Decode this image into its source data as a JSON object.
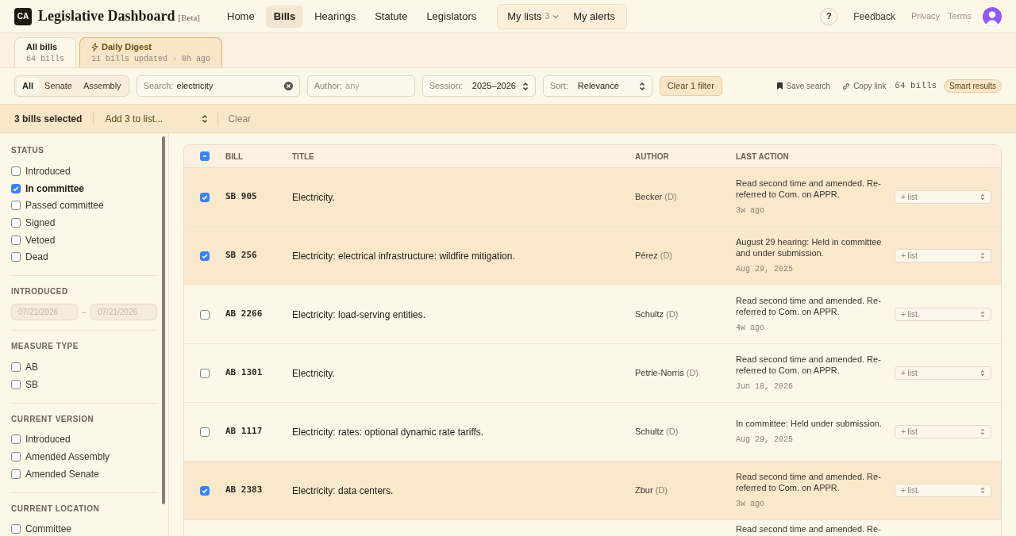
{
  "header": {
    "logo": "CA",
    "title": "Legislative Dashboard",
    "badge": "[Beta]",
    "nav": [
      {
        "label": "Home",
        "selected": false
      },
      {
        "label": "Bills",
        "selected": true
      },
      {
        "label": "Hearings",
        "selected": false
      },
      {
        "label": "Statute",
        "selected": false
      },
      {
        "label": "Legislators",
        "selected": false
      }
    ],
    "my_lists": {
      "label": "My lists",
      "count": "3"
    },
    "my_alerts": "My alerts",
    "help": "?",
    "feedback": "Feedback",
    "links": [
      "Privacy",
      "Terms"
    ]
  },
  "tabs": [
    {
      "label": "All bills",
      "sub": "64 bills",
      "selected": true,
      "kind": "plain"
    },
    {
      "label": "Daily Digest",
      "sub": "11 bills updated · 8h ago",
      "selected": false,
      "kind": "digest"
    }
  ],
  "filters": {
    "chamber": [
      {
        "label": "All",
        "selected": true
      },
      {
        "label": "Senate",
        "selected": false
      },
      {
        "label": "Assembly",
        "selected": false
      }
    ],
    "search": {
      "label": "Search:",
      "value": "electricity"
    },
    "author": {
      "label": "Author:",
      "placeholder": "any"
    },
    "session": {
      "label": "Session:",
      "value": "2025–2026"
    },
    "sort": {
      "label": "Sort:",
      "value": "Relevance"
    },
    "clear": "Clear 1 filter",
    "save": "Save search",
    "copy": "Copy link",
    "count": "64 bills",
    "smart": "Smart results"
  },
  "selection_bar": {
    "text": "3 bills selected",
    "action": "Add 3 to list...",
    "clear": "Clear"
  },
  "sidebar": [
    {
      "title": "STATUS",
      "kind": "checks",
      "items": [
        {
          "label": "Introduced",
          "checked": false
        },
        {
          "label": "In committee",
          "checked": true
        },
        {
          "label": "Passed committee",
          "checked": false
        },
        {
          "label": "Signed",
          "checked": false
        },
        {
          "label": "Vetoed",
          "checked": false
        },
        {
          "label": "Dead",
          "checked": false
        }
      ]
    },
    {
      "title": "INTRODUCED",
      "kind": "dates",
      "from": "07/21/2026",
      "to": "07/21/2026",
      "separator": "–"
    },
    {
      "title": "MEASURE TYPE",
      "kind": "checks",
      "items": [
        {
          "label": "AB",
          "checked": false
        },
        {
          "label": "SB",
          "checked": false
        }
      ]
    },
    {
      "title": "CURRENT VERSION",
      "kind": "checks",
      "items": [
        {
          "label": "Introduced",
          "checked": false
        },
        {
          "label": "Amended Assembly",
          "checked": false
        },
        {
          "label": "Amended Senate",
          "checked": false
        }
      ]
    },
    {
      "title": "CURRENT LOCATION",
      "kind": "checks",
      "items": [
        {
          "label": "Committee",
          "checked": false
        }
      ]
    }
  ],
  "table": {
    "header_checkbox": {
      "indeterminate": true
    },
    "columns": [
      "BILL",
      "TITLE",
      "AUTHOR",
      "LAST ACTION"
    ],
    "rows": [
      {
        "selected": true,
        "bill": "SB 905",
        "title": "Electricity.",
        "author": "Becker",
        "party": "(D)",
        "action": "Read second time and amended. Re-referred to Com. on APPR.",
        "when": "3w ago",
        "list": "+ list"
      },
      {
        "selected": true,
        "bill": "SB 256",
        "title": "Electricity: electrical infrastructure: wildfire mitigation.",
        "author": "Pérez",
        "party": "(D)",
        "action": "August 29 hearing: Held in committee and under submission.",
        "when": "Aug 29, 2025",
        "list": "+ list"
      },
      {
        "selected": false,
        "bill": "AB 2266",
        "title": "Electricity: load-serving entities.",
        "author": "Schultz",
        "party": "(D)",
        "action": "Read second time and amended. Re-referred to Com. on APPR.",
        "when": "4w ago",
        "list": "+ list"
      },
      {
        "selected": false,
        "bill": "AB 1301",
        "title": "Electricity.",
        "author": "Petrie-Norris",
        "party": "(D)",
        "action": "Read second time and amended. Re-referred to Com. on APPR.",
        "when": "Jun 18, 2026",
        "list": "+ list"
      },
      {
        "selected": false,
        "bill": "AB 1117",
        "title": "Electricity: rates: optional dynamic rate tariffs.",
        "author": "Schultz",
        "party": "(D)",
        "action": "In committee: Held under submission.",
        "when": "Aug 29, 2025",
        "list": "+ list"
      },
      {
        "selected": true,
        "bill": "AB 2383",
        "title": "Electricity: data centers.",
        "author": "Zbur",
        "party": "(D)",
        "action": "Read second time and amended. Re-referred to Com. on APPR.",
        "when": "3w ago",
        "list": "+ list"
      },
      {
        "action": "Read second time and amended. Re-"
      }
    ]
  }
}
